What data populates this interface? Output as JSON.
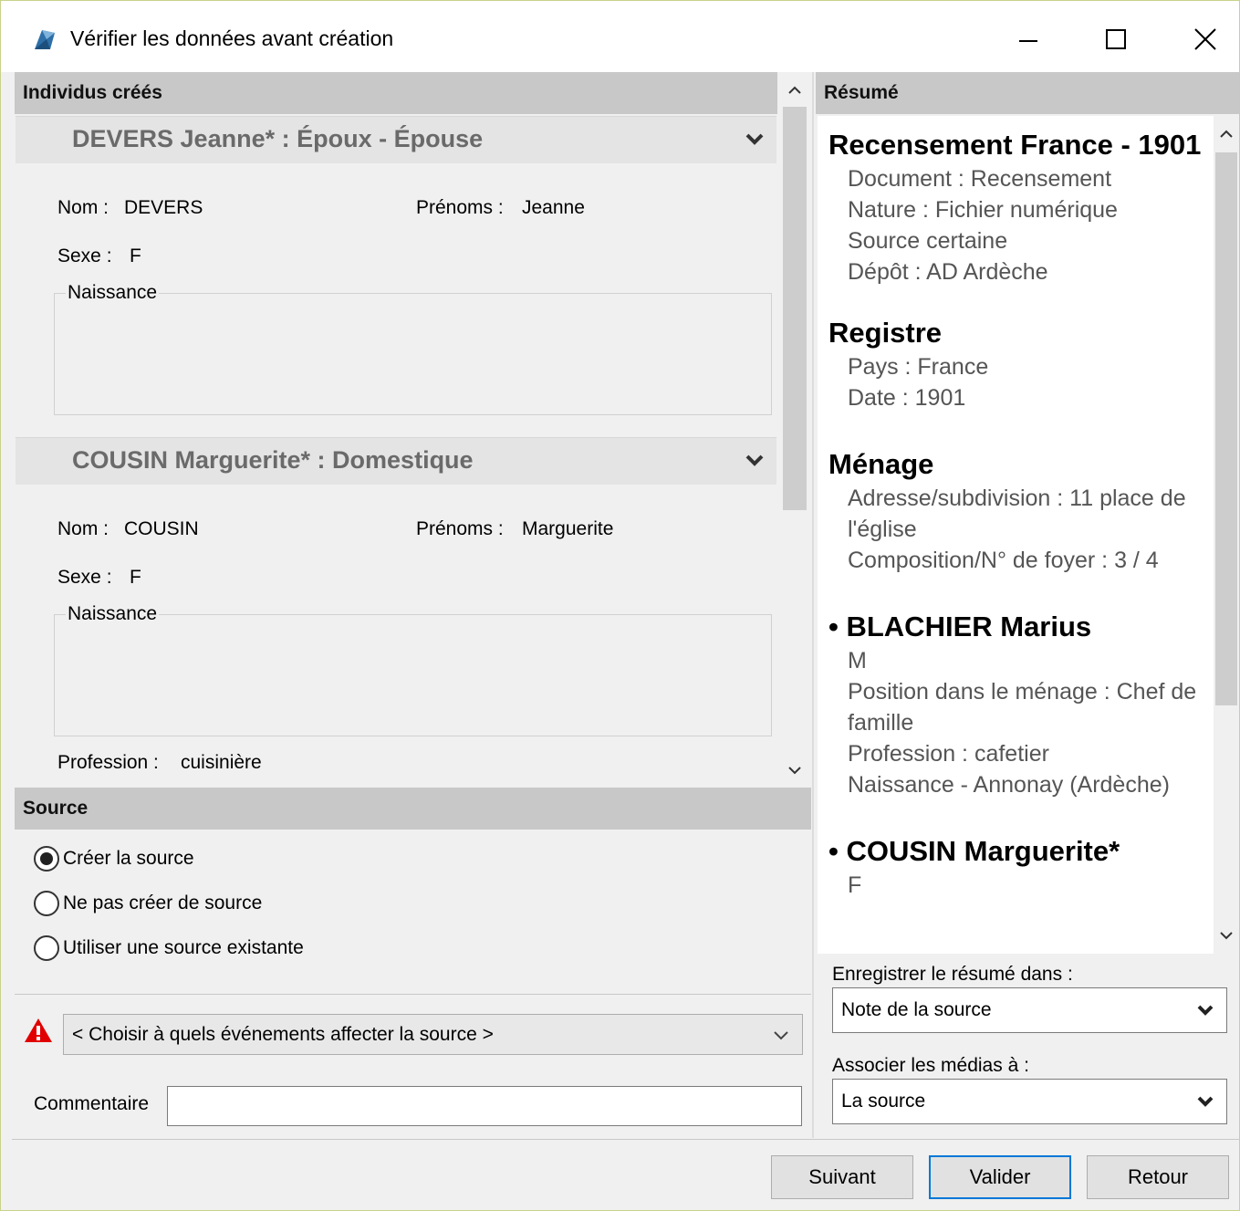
{
  "window": {
    "title": "Vérifier les données avant création",
    "minimize_glyph": "—",
    "maximize_glyph": "☐",
    "close_glyph": "✕"
  },
  "individuals": {
    "header": "Individus créés",
    "persons": [
      {
        "title": "DEVERS Jeanne* : Époux - Épouse",
        "nom_label": "Nom :",
        "nom": "DEVERS",
        "prenoms_label": "Prénoms :",
        "prenoms": "Jeanne",
        "sexe_label": "Sexe :",
        "sexe": "F",
        "naissance_label": "Naissance"
      },
      {
        "title": "COUSIN Marguerite* : Domestique",
        "nom_label": "Nom :",
        "nom": "COUSIN",
        "prenoms_label": "Prénoms :",
        "prenoms": "Marguerite",
        "sexe_label": "Sexe :",
        "sexe": "F",
        "naissance_label": "Naissance",
        "profession_label": "Profession :",
        "profession": "cuisinière"
      }
    ]
  },
  "source": {
    "header": "Source",
    "options": [
      "Créer la source",
      "Ne pas créer de source",
      "Utiliser une source existante"
    ],
    "selected": "Créer la source",
    "event_select": "< Choisir à quels événements affecter la source >",
    "comment_label": "Commentaire",
    "comment_value": ""
  },
  "summary": {
    "header": "Résumé",
    "blocks": [
      {
        "heading": "Recensement France - 1901",
        "lines": [
          "Document : Recensement",
          "Nature : Fichier numérique",
          "Source certaine",
          "Dépôt : AD Ardèche"
        ]
      },
      {
        "heading": "Registre",
        "lines": [
          "Pays : France",
          "Date : 1901"
        ]
      },
      {
        "heading": "Ménage",
        "lines": [
          "Adresse/subdivision : 11 place de l'église",
          "Composition/N° de foyer : 3 / 4"
        ]
      },
      {
        "heading": "• BLACHIER Marius",
        "lines": [
          "M",
          "Position dans le ménage : Chef de famille",
          "Profession : cafetier",
          "Naissance - Annonay (Ardèche)"
        ]
      },
      {
        "heading": "• COUSIN Marguerite*",
        "lines": [
          "F"
        ]
      }
    ],
    "save_label": "Enregistrer le résumé dans :",
    "save_value": "Note de la source",
    "media_label": "Associer les médias à :",
    "media_value": "La source"
  },
  "buttons": {
    "next": "Suivant",
    "validate": "Valider",
    "back": "Retour"
  },
  "colors": {
    "panel_header": "#c8c8c8",
    "accent": "#0078d7",
    "warning": "#e00000"
  }
}
